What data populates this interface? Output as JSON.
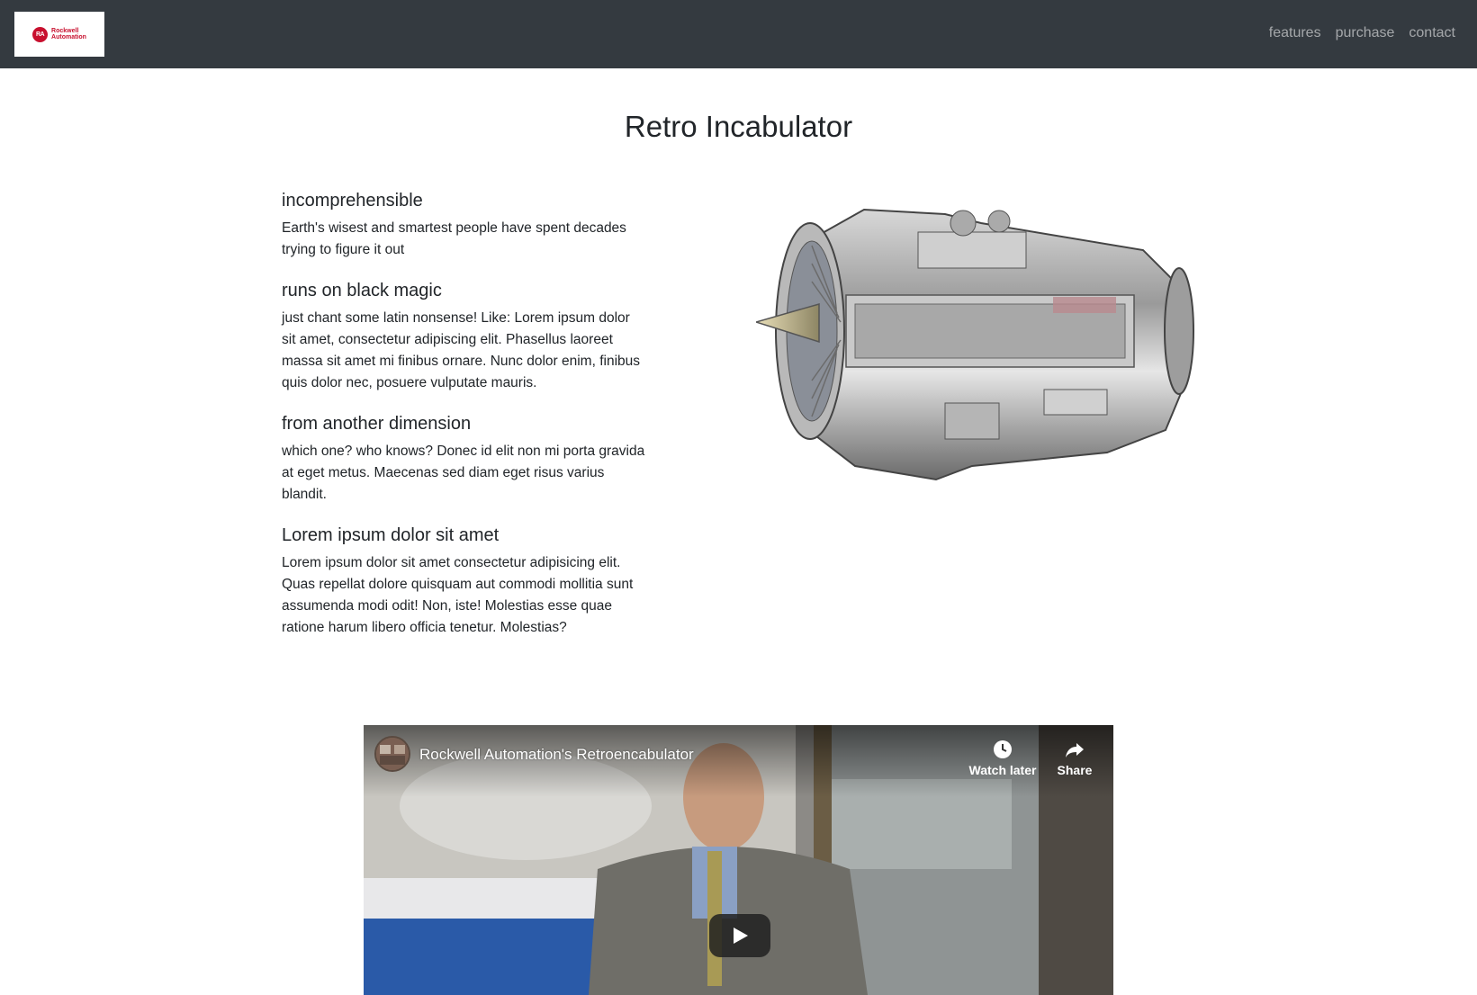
{
  "navbar": {
    "logo": {
      "mark": "RA",
      "line1": "Rockwell",
      "line2": "Automation"
    },
    "links": [
      {
        "label": "features"
      },
      {
        "label": "purchase"
      },
      {
        "label": "contact"
      }
    ]
  },
  "main": {
    "title": "Retro Incabulator",
    "features": [
      {
        "heading": "incomprehensible",
        "text": "Earth's wisest and smartest people have spent decades trying to figure it out"
      },
      {
        "heading": "runs on black magic",
        "text": "just chant some latin nonsense! Like: Lorem ipsum dolor sit amet, consectetur adipiscing elit. Phasellus laoreet massa sit amet mi finibus ornare. Nunc dolor enim, finibus quis dolor nec, posuere vulputate mauris."
      },
      {
        "heading": "from another dimension",
        "text": "which one? who knows? Donec id elit non mi porta gravida at eget metus. Maecenas sed diam eget risus varius blandit."
      },
      {
        "heading": "Lorem ipsum dolor sit amet",
        "text": "Lorem ipsum dolor sit amet consectetur adipisicing elit. Quas repellat dolore quisquam aut commodi mollitia sunt assumenda modi odit! Non, iste! Molestias esse quae ratione harum libero officia tenetur. Molestias?"
      }
    ]
  },
  "video": {
    "title": "Rockwell Automation's Retroencabulator",
    "watch_later": "Watch later",
    "share": "Share"
  },
  "colors": {
    "navbar_bg": "#343a40",
    "brand_red": "#c8102e",
    "play_button": "#212121"
  },
  "icons": {
    "logo": "rockwell-logo",
    "watch_later": "clock-icon",
    "share": "share-arrow-icon",
    "play": "play-icon"
  }
}
